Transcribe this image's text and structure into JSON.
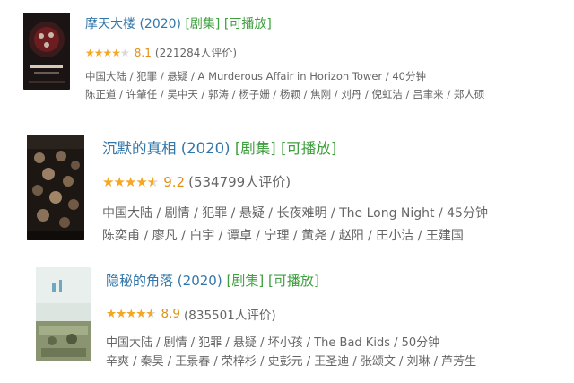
{
  "results": [
    {
      "title": "摩天大楼",
      "year": "(2020)",
      "tag_series": "[剧集]",
      "tag_playable": "[可播放]",
      "rating": 8.1,
      "stars_filled": 4,
      "score": "8.1",
      "rating_count": "(221284人评价)",
      "meta": "中国大陆 / 犯罪 / 悬疑 / A Murderous Affair in Horizon Tower / 40分钟",
      "cast": "陈正道 / 许肇任 / 吴中天 / 郭涛 / 杨子姗 / 杨颖 / 焦刚 / 刘丹 / 倪虹洁 / 吕聿来 / 郑人硕",
      "poster_colors": [
        "#2a1c1c",
        "#7a1f22"
      ]
    },
    {
      "title": "沉默的真相",
      "year": "(2020)",
      "tag_series": "[剧集]",
      "tag_playable": "[可播放]",
      "rating": 9.2,
      "stars_filled": 4.5,
      "score": "9.2",
      "rating_count": "(534799人评价)",
      "meta": "中国大陆 / 剧情 / 犯罪 / 悬疑 / 长夜难明 / The Long Night / 45分钟",
      "cast": "陈奕甫 / 廖凡 / 白宇 / 谭卓 / 宁理 / 黄尧 / 赵阳 / 田小洁 / 王建国",
      "poster_colors": [
        "#1e1a16",
        "#4a3a2a"
      ]
    },
    {
      "title": "隐秘的角落",
      "year": "(2020)",
      "tag_series": "[剧集]",
      "tag_playable": "[可播放]",
      "rating": 8.9,
      "stars_filled": 4.5,
      "score": "8.9",
      "rating_count": "(835501人评价)",
      "meta": "中国大陆 / 剧情 / 犯罪 / 悬疑 / 坏小孩 / The Bad Kids / 50分钟",
      "cast": "辛爽 / 秦昊 / 王景春 / 荣梓杉 / 史彭元 / 王圣迪 / 张颂文 / 刘琳 / 芦芳生",
      "poster_colors": [
        "#c9d6cf",
        "#7a8a6e"
      ]
    }
  ],
  "colors": {
    "link": "#3377aa",
    "tag": "#3d9f3d",
    "star": "#f5a623",
    "score": "#e09015",
    "meta": "#666666"
  }
}
